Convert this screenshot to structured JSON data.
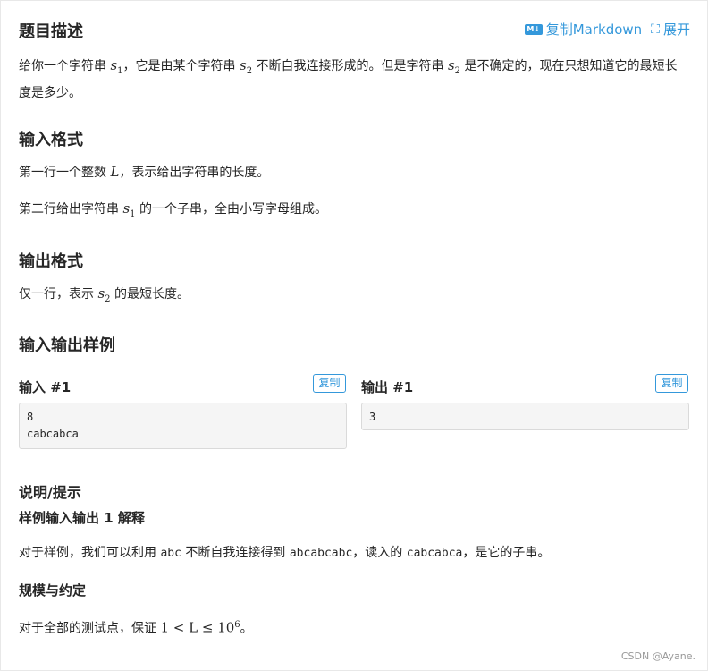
{
  "toolbar": {
    "md_icon_text": "M↓",
    "copy_markdown": "复制Markdown",
    "expand_icon": "⛶",
    "expand": "展开"
  },
  "description": {
    "title": "题目描述",
    "text_parts": [
      "给你一个字符串 ",
      "s",
      "1",
      "，它是由某个字符串 ",
      "s",
      "2",
      " 不断自我连接形成的。但是字符串 ",
      "s",
      "2",
      " 是不确定的，现在只想知道它的最短长度是多少。"
    ]
  },
  "input_format": {
    "title": "输入格式",
    "line1_parts": [
      "第一行一个整数 ",
      "L",
      "，表示给出字符串的长度。"
    ],
    "line2_parts": [
      "第二行给出字符串 ",
      "s",
      "1",
      " 的一个子串，全由小写字母组成。"
    ]
  },
  "output_format": {
    "title": "输出格式",
    "line_parts": [
      "仅一行，表示 ",
      "s",
      "2",
      " 的最短长度。"
    ]
  },
  "samples": {
    "title": "输入输出样例",
    "input_label": "输入 #1",
    "output_label": "输出 #1",
    "copy_label": "复制",
    "input_content": "8\ncabcabca",
    "output_content": "3"
  },
  "hint": {
    "title": "说明/提示",
    "sample_title": "样例输入输出 1 解释",
    "explain_parts": [
      "对于样例，我们可以利用 ",
      "abc",
      " 不断自我连接得到 ",
      "abcabcabc",
      "，读入的 ",
      "cabcabca",
      "，是它的子串。"
    ],
    "scale_title": "规模与约定",
    "scale_parts": [
      "对于全部的测试点，保证 ",
      "1 < L ≤ 10",
      "6",
      "。"
    ]
  },
  "watermark": "CSDN @Ayane."
}
